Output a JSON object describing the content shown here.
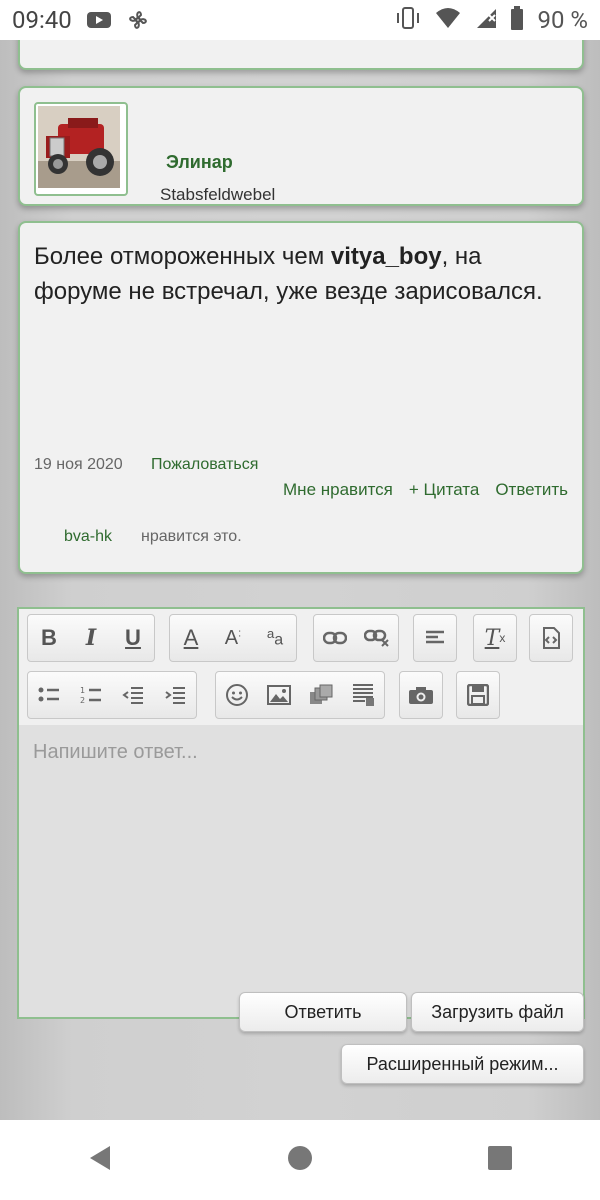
{
  "status_bar": {
    "time": "09:40",
    "battery_text": "90 %",
    "icons": [
      "youtube-icon",
      "fan-icon",
      "vibrate-icon",
      "wifi-icon",
      "signal-icon",
      "battery-icon"
    ]
  },
  "author": {
    "name": "Элинар",
    "rank": "Stabsfeldwebel"
  },
  "post": {
    "text_before": "Более отмороженных чем ",
    "mention": "vitya_boy",
    "text_after": ", на форуме не встречал, уже везде зарисовался.",
    "date": "19 ноя 2020",
    "report_label": "Пожаловаться",
    "like_label": "Мне нравится",
    "quote_label": "+ Цитата",
    "reply_label": "Ответить",
    "liked_by": "bva-hk",
    "liked_suffix": "нравится это."
  },
  "editor": {
    "placeholder": "Напишите ответ...",
    "toolbar_row1": [
      "bold-icon",
      "italic-icon",
      "underline-icon",
      "font-color-icon",
      "font-size-icon",
      "font-case-icon",
      "link-icon",
      "unlink-icon",
      "align-icon",
      "clear-format-icon",
      "source-icon"
    ],
    "toolbar_row2": [
      "bullet-list-icon",
      "numbered-list-icon",
      "outdent-icon",
      "indent-icon",
      "smiley-icon",
      "image-icon",
      "media-icon",
      "template-icon",
      "camera-icon",
      "save-icon"
    ]
  },
  "actions": {
    "reply_button": "Ответить",
    "upload_button": "Загрузить файл",
    "advanced_button": "Расширенный режим..."
  },
  "colors": {
    "accent_green": "#2f6b2f",
    "border_green": "#8fbf8f"
  }
}
